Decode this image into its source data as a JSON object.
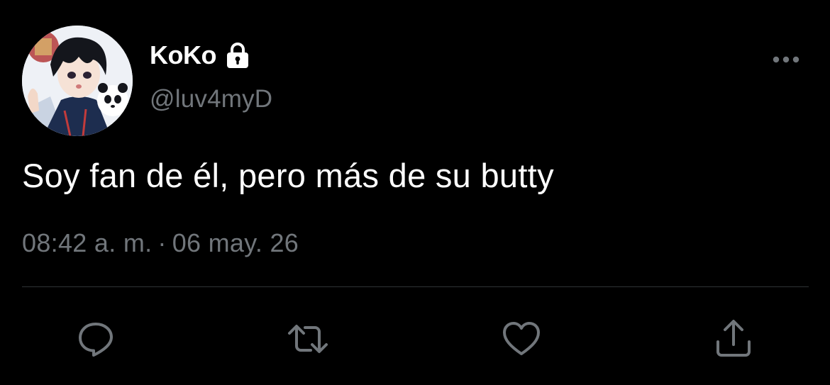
{
  "tweet": {
    "display_name": "KoKo",
    "handle": "@luv4myD",
    "text": "Soy fan de él, pero más de su butty",
    "time": "08:42 a. m.",
    "separator": "·",
    "date": "06 may. 26"
  },
  "icons": {
    "avatar": "profile-avatar",
    "lock": "lock-icon",
    "more": "more-icon",
    "reply": "reply-icon",
    "retweet": "retweet-icon",
    "like": "like-icon",
    "share": "share-icon"
  },
  "colors": {
    "background": "#000000",
    "primary_text": "#ffffff",
    "secondary_text": "#71767b",
    "divider": "#2f3336",
    "icon": "#71767b"
  }
}
